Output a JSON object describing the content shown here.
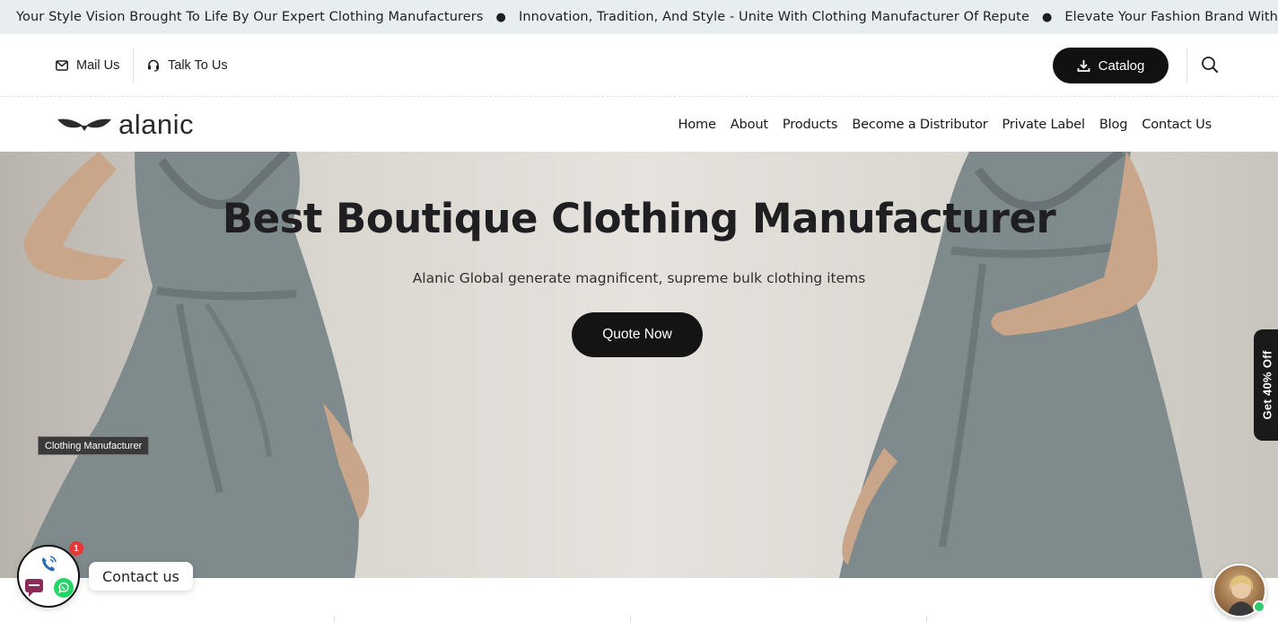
{
  "ticker": {
    "items": [
      "Your Style Vision Brought To Life By Our Expert Clothing Manufacturers",
      "Innovation, Tradition, And Style - Unite With Clothing Manufacturer Of Repute",
      "Elevate Your Fashion Brand With Tr"
    ],
    "separator": "●"
  },
  "utility": {
    "mail_label": "Mail Us",
    "talk_label": "Talk To Us",
    "catalog_label": "Catalog"
  },
  "nav": {
    "logo_text": "alanic",
    "links": [
      "Home",
      "About",
      "Products",
      "Become a Distributor",
      "Private Label",
      "Blog",
      "Contact Us"
    ]
  },
  "hero": {
    "title": "Best Boutique Clothing Manufacturer",
    "subtitle": "Alanic Global generate magnificent, supreme bulk clothing items",
    "cta_label": "Quote Now",
    "image_label": "Clothing Manufacturer"
  },
  "side_tab": {
    "label": "Get 40% Off"
  },
  "contact_widget": {
    "label": "Contact us",
    "badge_count": "1"
  },
  "colors": {
    "ticker_bg": "#e8edf0",
    "button_dark": "#111111",
    "badge_red": "#e53935",
    "online_green": "#2ecc71",
    "dress_grey": "#7f8a8c"
  },
  "icons": [
    "mail-icon",
    "headset-icon",
    "download-icon",
    "search-icon",
    "phone-icon",
    "chat-icon",
    "whatsapp-icon"
  ]
}
